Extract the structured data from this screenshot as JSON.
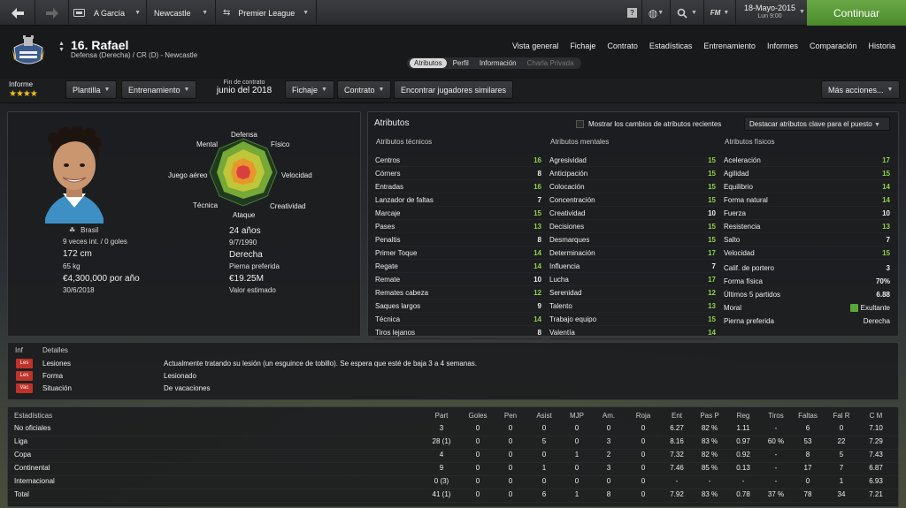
{
  "topbar": {
    "manager": "A García",
    "club": "Newcastle",
    "competition": "Premier League",
    "date": "18-Mayo-2015",
    "time": "Lun 9:00",
    "continue_label": "Continuar"
  },
  "header": {
    "player_name": "16. Rafael",
    "position": "Defensa (Derecha) / CR (D) - Newcastle",
    "nav": [
      "Vista general",
      "Fichaje",
      "Contrato",
      "Estadísticas",
      "Entrenamiento",
      "Informes",
      "Comparación",
      "Historia"
    ],
    "subtabs": [
      "Atributos",
      "Perfil",
      "Información",
      "Charla Privada"
    ]
  },
  "toolbar": {
    "informe_label": "Informe",
    "stars": "★★★★",
    "plantilla": "Plantilla",
    "entrenamiento": "Entrenamiento",
    "contract_end_label": "Fin de contrato",
    "contract_end_value": "junio del 2018",
    "fichaje": "Fichaje",
    "contrato": "Contrato",
    "similar": "Encontrar jugadores similares",
    "more": "Más acciones..."
  },
  "profile": {
    "nationality": "Brasil",
    "caps": "9 veces int. / 0 goles",
    "height": "172 cm",
    "weight": "65 kg",
    "wage": "€4,300,000 por año",
    "contract_date": "30/6/2018",
    "age": "24 años",
    "dob": "9/7/1990",
    "foot": "Derecha",
    "foot_label": "Pierna preferida",
    "value": "€19.25M",
    "value_label": "Valor estimado"
  },
  "radar": {
    "labels": [
      "Defensa",
      "Físico",
      "Velocidad",
      "Creatividad",
      "Ataque",
      "Técnica",
      "Juego aéreo",
      "Mental"
    ]
  },
  "attributes": {
    "title": "Atributos",
    "show_changes": "Mostrar los cambios de atributos recientes",
    "highlight": "Destacar atributos clave para el puesto",
    "tecnicos_label": "Atributos técnicos",
    "mentales_label": "Atributos mentales",
    "fisicos_label": "Atributos físicos",
    "tecnicos": [
      {
        "name": "Centros",
        "value": "16"
      },
      {
        "name": "Córners",
        "value": "8"
      },
      {
        "name": "Entradas",
        "value": "16"
      },
      {
        "name": "Lanzador de faltas",
        "value": "7"
      },
      {
        "name": "Marcaje",
        "value": "15"
      },
      {
        "name": "Pases",
        "value": "13"
      },
      {
        "name": "Penaltis",
        "value": "8"
      },
      {
        "name": "Primer Toque",
        "value": "14"
      },
      {
        "name": "Regate",
        "value": "14"
      },
      {
        "name": "Remate",
        "value": "10"
      },
      {
        "name": "Remates cabeza",
        "value": "12"
      },
      {
        "name": "Saques largos",
        "value": "9"
      },
      {
        "name": "Técnica",
        "value": "14"
      },
      {
        "name": "Tiros lejanos",
        "value": "8"
      }
    ],
    "mentales": [
      {
        "name": "Agresividad",
        "value": "15"
      },
      {
        "name": "Anticipación",
        "value": "15"
      },
      {
        "name": "Colocación",
        "value": "15"
      },
      {
        "name": "Concentración",
        "value": "15"
      },
      {
        "name": "Creatividad",
        "value": "10"
      },
      {
        "name": "Decisiones",
        "value": "15"
      },
      {
        "name": "Desmarques",
        "value": "15"
      },
      {
        "name": "Determinación",
        "value": "17"
      },
      {
        "name": "Influencia",
        "value": "7"
      },
      {
        "name": "Lucha",
        "value": "17"
      },
      {
        "name": "Serenidad",
        "value": "12"
      },
      {
        "name": "Talento",
        "value": "13"
      },
      {
        "name": "Trabajo equipo",
        "value": "15"
      },
      {
        "name": "Valentía",
        "value": "14"
      }
    ],
    "fisicos": [
      {
        "name": "Aceleración",
        "value": "17"
      },
      {
        "name": "Agilidad",
        "value": "15"
      },
      {
        "name": "Equilibrio",
        "value": "14"
      },
      {
        "name": "Forma natural",
        "value": "14"
      },
      {
        "name": "Fuerza",
        "value": "10"
      },
      {
        "name": "Resistencia",
        "value": "13"
      },
      {
        "name": "Salto",
        "value": "7"
      },
      {
        "name": "Velocidad",
        "value": "15"
      }
    ],
    "extra": [
      {
        "name": "Calif. de portero",
        "value": "3"
      },
      {
        "name": "Forma física",
        "value": "70%"
      },
      {
        "name": "Últimos 5 partidos",
        "value": "6.88"
      },
      {
        "name": "Moral",
        "value": "Exultante"
      },
      {
        "name": "Pierna preferida",
        "value": "Derecha"
      }
    ]
  },
  "injuries": {
    "inf_label": "Inf",
    "details_label": "Detalles",
    "rows": [
      {
        "badge": "Les",
        "label": "Lesiones",
        "detail": "Actualmente tratando su lesión (un esguince de tobillo). Se espera que esté de baja 3 a 4 semanas."
      },
      {
        "badge": "Les",
        "label": "Forma",
        "detail": "Lesionado"
      },
      {
        "badge": "Vac",
        "label": "Situación",
        "detail": "De vacaciones"
      }
    ]
  },
  "stats": {
    "title": "Estadísticas",
    "columns": [
      "Part",
      "Goles",
      "Pen",
      "Asist",
      "MJP",
      "Am.",
      "Roja",
      "Ent",
      "Pas P",
      "Reg",
      "Tiros",
      "Faltas",
      "Fal R",
      "C M"
    ],
    "rows": [
      {
        "label": "No oficiales",
        "values": [
          "3",
          "0",
          "0",
          "0",
          "0",
          "0",
          "0",
          "6.27",
          "82 %",
          "1.11",
          "-",
          "6",
          "0",
          "7.10"
        ]
      },
      {
        "label": "Liga",
        "values": [
          "28 (1)",
          "0",
          "0",
          "5",
          "0",
          "3",
          "0",
          "8.16",
          "83 %",
          "0.97",
          "60 %",
          "53",
          "22",
          "7.29"
        ]
      },
      {
        "label": "Copa",
        "values": [
          "4",
          "0",
          "0",
          "0",
          "1",
          "2",
          "0",
          "7.32",
          "82 %",
          "0.92",
          "-",
          "8",
          "5",
          "7.43"
        ]
      },
      {
        "label": "Continental",
        "values": [
          "9",
          "0",
          "0",
          "1",
          "0",
          "3",
          "0",
          "7.46",
          "85 %",
          "0.13",
          "-",
          "17",
          "7",
          "6.87"
        ]
      },
      {
        "label": "Internacional",
        "values": [
          "0 (3)",
          "0",
          "0",
          "0",
          "0",
          "0",
          "0",
          "-",
          "-",
          "-",
          "-",
          "0",
          "1",
          "6.93"
        ]
      },
      {
        "label": "Total",
        "values": [
          "41 (1)",
          "0",
          "0",
          "6",
          "1",
          "8",
          "0",
          "7.92",
          "83 %",
          "0.78",
          "37 %",
          "78",
          "34",
          "7.21"
        ]
      }
    ]
  }
}
